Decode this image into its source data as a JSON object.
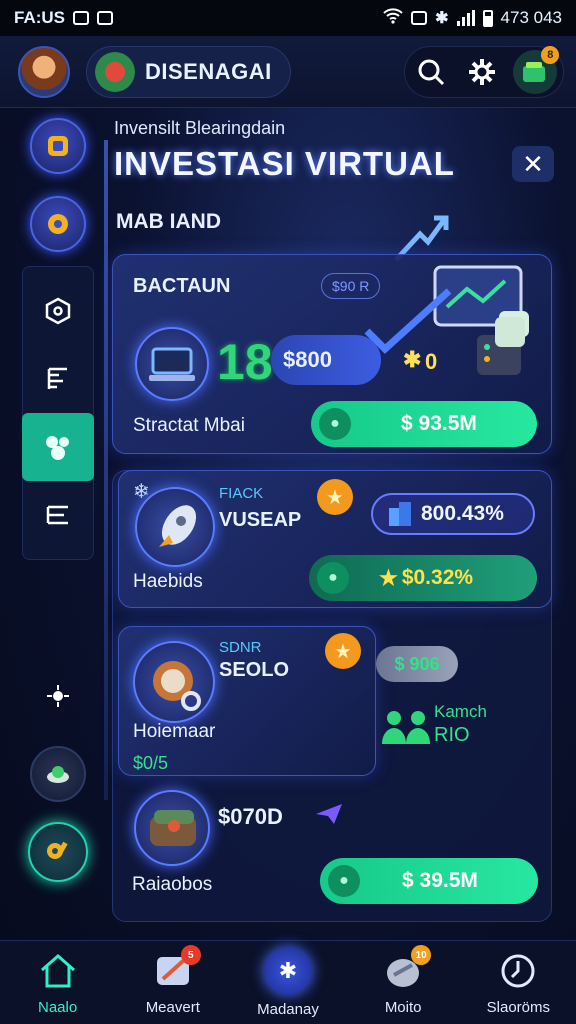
{
  "status_bar": {
    "left_text": "FA:US",
    "right_text": "473 043"
  },
  "header": {
    "brand_name": "DISENAGAI",
    "wallet_badge": "8"
  },
  "page": {
    "subtitle": "Invensilt Blearingdain",
    "title": "INVESTASI VIRTUAL",
    "close_glyph": "✕",
    "section_label": "MAB IAND"
  },
  "cards": {
    "card1": {
      "title": "BACTAUN",
      "tag": "$90 R",
      "big_value": "18",
      "amount": "$800",
      "star_value": "0",
      "row_label": "Stractat Mbai",
      "pill_value": "$ 93.5M"
    },
    "card2": {
      "small_label": "FIACK",
      "name": "VUSEAP",
      "percent_value": "800.43%",
      "row_label": "Haebids",
      "pill_value": "$0.32%"
    },
    "card3": {
      "small_label": "SDNR",
      "name": "SEOLO",
      "row_label": "Hoiemaar",
      "sub_value": "$0/5",
      "chip_value": "$ 906",
      "side_title": "Kamch",
      "side_sub": "RIO"
    },
    "card4": {
      "amount": "$070D",
      "row_label": "Raiaobos",
      "pill_value": "$ 39.5M"
    }
  },
  "bottom_nav": [
    {
      "label": "Naalo",
      "icon": "home-icon",
      "badge": ""
    },
    {
      "label": "Meavert",
      "icon": "market-icon",
      "badge": "5"
    },
    {
      "label": "Madanay",
      "icon": "center-orb-icon",
      "badge": ""
    },
    {
      "label": "Moito",
      "icon": "shield-icon",
      "badge": "10"
    },
    {
      "label": "Slaoröms",
      "icon": "clock-icon",
      "badge": ""
    }
  ],
  "colors": {
    "accent": "#2ff0c8",
    "pill_green": "#1fd896",
    "panel": "#223276",
    "badge": "#e53a2a",
    "star": "#f39a1e"
  }
}
